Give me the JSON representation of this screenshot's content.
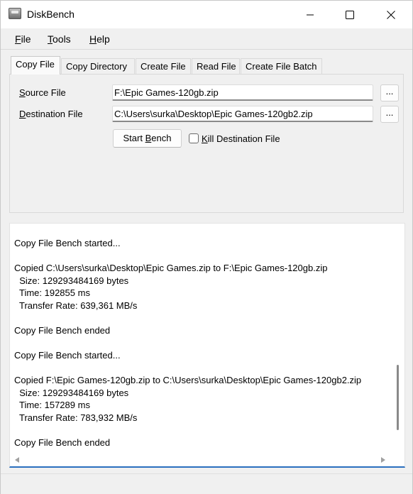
{
  "window": {
    "title": "DiskBench",
    "icons": {
      "app": "disk-icon",
      "minimize": "minimize-icon",
      "maximize": "maximize-icon",
      "close": "close-icon"
    }
  },
  "menu": {
    "file": {
      "accel": "F",
      "rest": "ile"
    },
    "tools": {
      "accel": "T",
      "rest": "ools"
    },
    "help": {
      "accel": "H",
      "rest": "elp"
    }
  },
  "tabs": [
    {
      "label": "Copy File",
      "active": true
    },
    {
      "label": "Copy Directory",
      "active": false
    },
    {
      "label": "Create File",
      "active": false
    },
    {
      "label": "Read File",
      "active": false
    },
    {
      "label": "Create File Batch",
      "active": false
    }
  ],
  "form": {
    "source_label": {
      "accel": "S",
      "rest": "ource File"
    },
    "source_value": "F:\\Epic Games-120gb.zip",
    "destination_label": {
      "accel": "D",
      "rest": "estination File"
    },
    "destination_value": "C:\\Users\\surka\\Desktop\\Epic Games-120gb2.zip",
    "browse_label": "...",
    "start_button": {
      "pre": "Start ",
      "accel": "B",
      "rest": "ench"
    },
    "kill_checkbox": {
      "accel": "K",
      "rest": "ill Destination File",
      "checked": false
    }
  },
  "log": {
    "lines": [
      "Copy File Bench started...",
      "",
      "Copied C:\\Users\\surka\\Desktop\\Epic Games.zip to F:\\Epic Games-120gb.zip",
      "  Size: 129293484169 bytes",
      "  Time: 192855 ms",
      "  Transfer Rate: 639,361 MB/s",
      "",
      "Copy File Bench ended",
      "",
      "Copy File Bench started...",
      "",
      "Copied F:\\Epic Games-120gb.zip to C:\\Users\\surka\\Desktop\\Epic Games-120gb2.zip",
      "  Size: 129293484169 bytes",
      "  Time: 157289 ms",
      "  Transfer Rate: 783,932 MB/s",
      "",
      "Copy File Bench ended"
    ]
  },
  "colors": {
    "accent": "#2a6fbf",
    "window_bg": "#f0f0f0",
    "titlebar_bg": "#ffffff"
  }
}
